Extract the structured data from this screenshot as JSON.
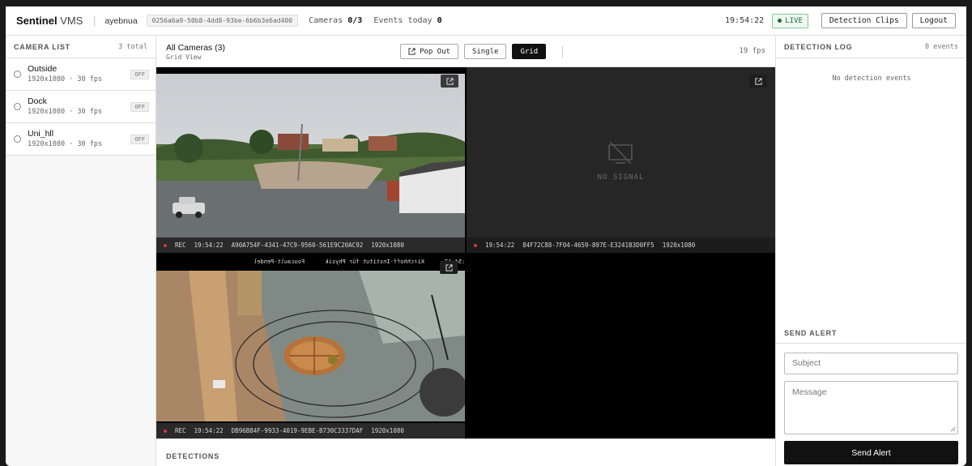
{
  "header": {
    "brand_bold": "Sentinel",
    "brand_rest": "VMS",
    "user": "ayebnua",
    "session_id": "0256a6a9-50b8-4dd8-93be-6b6b3e6ad400",
    "cameras_label": "Cameras",
    "cameras_value": "0/3",
    "events_label": "Events today",
    "events_value": "0",
    "clock": "19:54:22",
    "live_label": "LIVE",
    "detection_clips_label": "Detection Clips",
    "logout_label": "Logout"
  },
  "sidebar": {
    "title": "CAMERA LIST",
    "count": "3 total",
    "cameras": [
      {
        "name": "Outside",
        "meta": "1920x1080 · 30 fps",
        "status": "OFF"
      },
      {
        "name": "Dock",
        "meta": "1920x1080 · 30 fps",
        "status": "OFF"
      },
      {
        "name": "Uni_hll",
        "meta": "1920x1080 · 30 fps",
        "status": "OFF"
      }
    ]
  },
  "toolbar": {
    "title": "All Cameras (3)",
    "subtitle": "Grid View",
    "popout_label": "Pop Out",
    "single_label": "Single",
    "grid_label": "Grid",
    "fps": "19 fps"
  },
  "tiles": [
    {
      "rec": "REC",
      "time": "19:54:22",
      "id": "A90A754F-4341-47C9-9560-561E9C20AC92",
      "res": "1920x1080"
    },
    {
      "no_signal": "NO SIGNAL",
      "time": "19:54:22",
      "id": "84F72C88-7F04-4659-897E-E3241B3D0FF5",
      "res": "1920x1080"
    },
    {
      "rec": "REC",
      "time": "19:54:22",
      "id": "DB96B84F-9933-4019-9EBE-B730C3337DAF",
      "res": "1920x1080",
      "overlay": "08-08-2026 20:54:17      Kirchhoff-Institut für Physik      Foucault-Pendel"
    },
    {}
  ],
  "detections": {
    "title": "DETECTIONS"
  },
  "detection_log": {
    "title": "DETECTION LOG",
    "count": "0 events",
    "empty": "No detection events"
  },
  "alert": {
    "title": "SEND ALERT",
    "subject_placeholder": "Subject",
    "message_placeholder": "Message",
    "send_label": "Send Alert"
  },
  "colors": {
    "accent": "#111111",
    "live": "#1f6b3a",
    "rec": "#d23b3b"
  }
}
